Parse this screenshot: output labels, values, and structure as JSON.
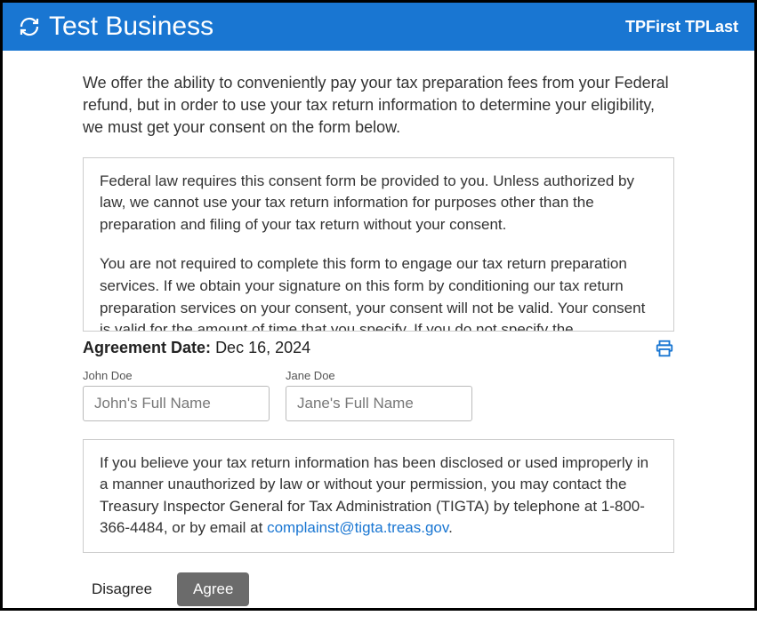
{
  "header": {
    "business_name": "Test Business",
    "user_name": "TPFirst TPLast"
  },
  "intro": "We offer the ability to conveniently pay your tax preparation fees from your Federal refund, but in order to use your tax return information to determine your eligibility, we must get your consent on the form below.",
  "consent": {
    "para1": "Federal law requires this consent form be provided to you. Unless authorized by law, we cannot use your tax return information for purposes other than the preparation and filing of your tax return without your consent.",
    "para2": "You are not required to complete this form to engage our tax return preparation services. If we obtain your signature on this form by conditioning our tax return preparation services on your consent, your consent will not be valid. Your consent is valid for the amount of time that you specify. If you do not specify the"
  },
  "agreement": {
    "label": "Agreement Date:",
    "date": "Dec 16, 2024"
  },
  "fields": {
    "primary": {
      "label": "John Doe",
      "placeholder": "John's Full Name"
    },
    "secondary": {
      "label": "Jane Doe",
      "placeholder": "Jane's Full Name"
    }
  },
  "disclosure": {
    "text_before_link": "If you believe your tax return information has been disclosed or used improperly in a manner unauthorized by law or without your permission, you may contact the Treasury Inspector General for Tax Administration (TIGTA) by telephone at 1-800-366-4484, or by email at ",
    "link_text": "complainst@tigta.treas.gov",
    "text_after_link": "."
  },
  "buttons": {
    "disagree": "Disagree",
    "agree": "Agree"
  }
}
